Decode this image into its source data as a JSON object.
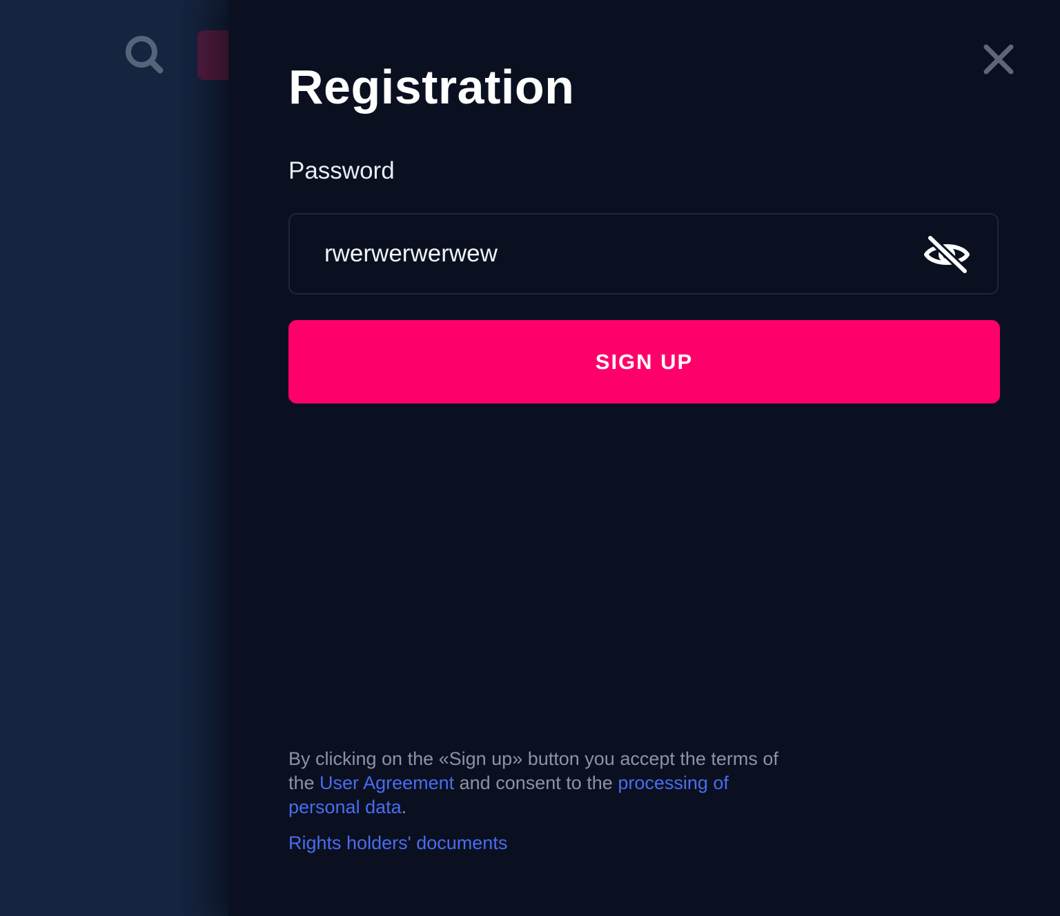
{
  "modal": {
    "title": "Registration",
    "password": {
      "label": "Password",
      "value": "rwerwerwerwew"
    },
    "signup_button": "SIGN UP",
    "legal": {
      "text_1": "By clicking on the «Sign up» button you accept the terms of the ",
      "user_agreement_link": "User Agreement",
      "text_2": " and consent to the ",
      "personal_data_link": "processing of personal data",
      "text_3": "."
    },
    "rights_holders_link": "Rights holders' documents"
  },
  "colors": {
    "accent": "#ff006b",
    "link": "#4a6cf0",
    "modal_bg": "#0a1020",
    "page_bg": "#15243f"
  },
  "icons": {
    "search": "search-icon",
    "close": "close-icon",
    "password_visibility": "eye-off-icon"
  }
}
